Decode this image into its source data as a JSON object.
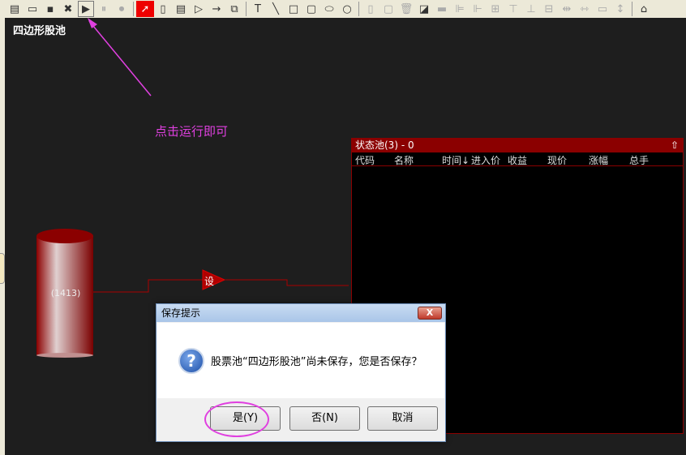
{
  "toolbar": {
    "icons": [
      "new-icon",
      "open-icon",
      "save-icon",
      "delete-icon",
      "run-icon",
      "pause-icon",
      "stop-icon",
      "|",
      "select-icon",
      "pool-icon",
      "list-icon",
      "condition-icon",
      "arrow-icon",
      "group-icon",
      "|",
      "text-icon",
      "line-icon",
      "rect-icon",
      "round-rect-icon",
      "ellipse-icon",
      "circle-icon",
      "|",
      "copy-icon",
      "paste-icon",
      "trash-icon",
      "fill-icon",
      "line-style-icon",
      "align-left-icon",
      "align-right-icon",
      "align-center-icon",
      "align-top-icon",
      "align-bottom-icon",
      "align-middle-icon",
      "space-h-icon",
      "space-v-icon",
      "same-width-icon",
      "same-height-icon",
      "|",
      "bank-icon"
    ],
    "glyphs": [
      "▤",
      "▭",
      "▪",
      "✖",
      "▶",
      "⏸",
      "⏺",
      "",
      "➚",
      "▯",
      "▤",
      "▷",
      "→",
      "⧉",
      "",
      "T",
      "╲",
      "□",
      "▢",
      "⬭",
      "○",
      "",
      "▯",
      "▢",
      "🗑",
      "◪",
      "▬",
      "⊫",
      "⊩",
      "⊞",
      "⊤",
      "⊥",
      "⊟",
      "⇹",
      "⇿",
      "▭",
      "↕",
      "",
      "⌂"
    ]
  },
  "canvas": {
    "title": "四边形股池",
    "hint": "点击运行即可",
    "pool_count": "(1413)",
    "node_label": "设"
  },
  "pool": {
    "title": "状态池(3) - 0",
    "columns": [
      "代码",
      "名称",
      "时间↓",
      "进入价",
      "收益",
      "现价",
      "涨幅",
      "总手"
    ]
  },
  "dialog": {
    "title": "保存提示",
    "close": "X",
    "message": "股票池“四边形股池”尚未保存，您是否保存？",
    "yes": "是(Y)",
    "no": "否(N)",
    "cancel": "取消"
  },
  "colors": {
    "accent": "#8b0000",
    "highlight": "#e040e0"
  }
}
